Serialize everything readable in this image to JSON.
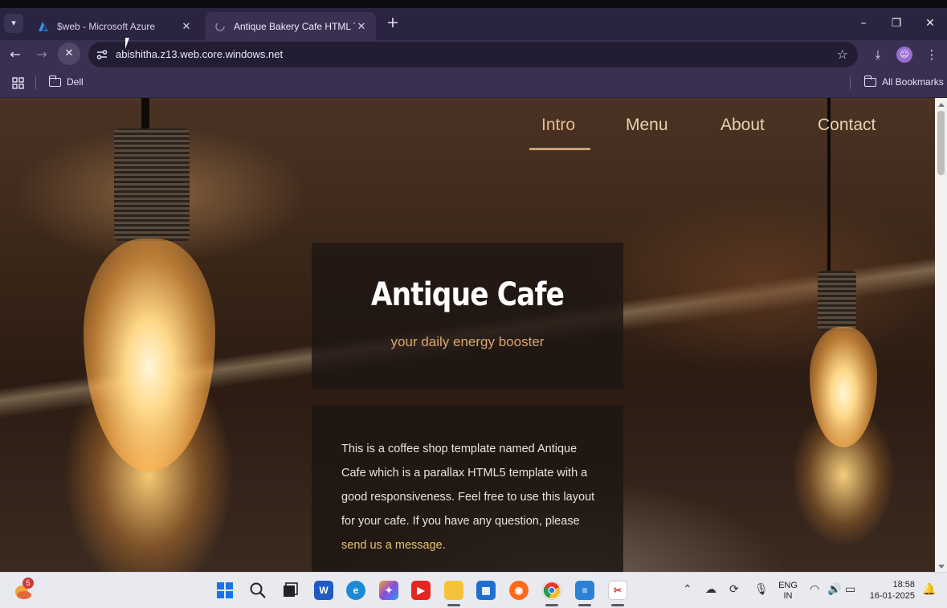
{
  "browser": {
    "tabs": [
      {
        "title": "$web - Microsoft Azure",
        "icon": "azure-logo-icon",
        "active": false
      },
      {
        "title": "Antique Bakery Cafe HTML Tem",
        "icon": "loading-icon",
        "active": true
      }
    ],
    "url": "abishitha.z13.web.core.windows.net",
    "bookmarks": {
      "folder": "Dell",
      "all_bookmarks": "All Bookmarks"
    }
  },
  "page": {
    "nav": [
      {
        "label": "Intro",
        "active": true
      },
      {
        "label": "Menu",
        "active": false
      },
      {
        "label": "About",
        "active": false
      },
      {
        "label": "Contact",
        "active": false
      }
    ],
    "hero": {
      "title": "Antique Cafe",
      "subtitle": "your daily energy booster"
    },
    "description": {
      "text": "This is a coffee shop template named Antique Cafe which is a parallax HTML5 template with a good responsiveness. Feel free to use this layout for your cafe. If you have any question, please",
      "link": "send us a message."
    },
    "colors": {
      "accent": "#d8a572",
      "link": "#e6c46a"
    }
  },
  "taskbar": {
    "weather_badge": "5",
    "language": {
      "line1": "ENG",
      "line2": "IN"
    },
    "time": "18:58",
    "date": "16-01-2025"
  }
}
